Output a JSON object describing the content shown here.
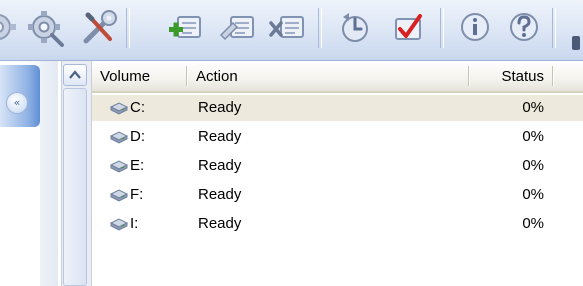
{
  "toolbar": {
    "buttons": [
      {
        "icon": "settings-icon"
      },
      {
        "icon": "settings-icon"
      },
      {
        "icon": "tools-icon"
      },
      {
        "icon": "add-job-icon"
      },
      {
        "icon": "edit-job-icon"
      },
      {
        "icon": "remove-job-icon"
      },
      {
        "icon": "update-icon"
      },
      {
        "icon": "check-icon"
      },
      {
        "icon": "info-icon"
      },
      {
        "icon": "help-icon"
      }
    ]
  },
  "list": {
    "columns": {
      "volume": "Volume",
      "action": "Action",
      "status": "Status"
    },
    "rows": [
      {
        "volume": "C:",
        "action": "Ready",
        "status": "0%",
        "selected": true
      },
      {
        "volume": "D:",
        "action": "Ready",
        "status": "0%",
        "selected": false
      },
      {
        "volume": "E:",
        "action": "Ready",
        "status": "0%",
        "selected": false
      },
      {
        "volume": "F:",
        "action": "Ready",
        "status": "0%",
        "selected": false
      },
      {
        "volume": "I:",
        "action": "Ready",
        "status": "0%",
        "selected": false
      }
    ]
  },
  "colors": {
    "toolbar_bg": "#dfe8f6",
    "selected_row": "#ede9dc",
    "panel_blue": "#8fb2e4",
    "accent_green": "#3a9b2a",
    "accent_red": "#d92020"
  }
}
